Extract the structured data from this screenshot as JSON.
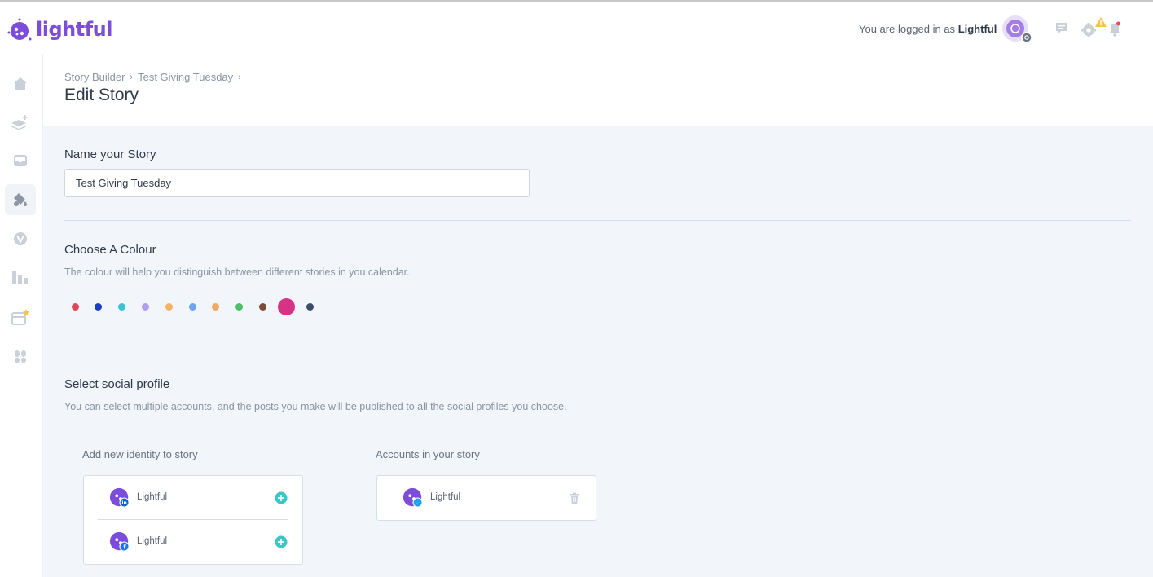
{
  "brand": {
    "name": "lightful",
    "color": "#7c4ddb"
  },
  "topbar": {
    "logged_prefix": "You are logged in as",
    "logged_user": "Lightful",
    "icons": [
      "avatar",
      "chat-icon",
      "gear-icon",
      "warning-icon",
      "bell-icon"
    ]
  },
  "sidebar": {
    "items": [
      {
        "icon": "home-icon"
      },
      {
        "icon": "layers-add-icon"
      },
      {
        "icon": "inbox-icon"
      },
      {
        "icon": "paint-bucket-icon",
        "active": true
      },
      {
        "icon": "leaf-icon"
      },
      {
        "icon": "bar-chart-icon"
      },
      {
        "icon": "calendar-star-icon"
      },
      {
        "icon": "footprints-icon"
      }
    ]
  },
  "breadcrumb": [
    "Story Builder",
    "Test Giving Tuesday"
  ],
  "page_title": "Edit Story",
  "name_section": {
    "title": "Name your Story",
    "value": "Test Giving Tuesday"
  },
  "colour_section": {
    "title": "Choose A Colour",
    "description": "The colour will help you distinguish between different stories in you calendar.",
    "colors": [
      "#e0445a",
      "#1a3fc7",
      "#3cc4d6",
      "#b49cf0",
      "#f7b267",
      "#6ea6ee",
      "#f3a864",
      "#4cbf62",
      "#7a4a3a",
      "#d63384",
      "#3e4c68"
    ],
    "selected_index": 9
  },
  "social_section": {
    "title": "Select social profile",
    "description": "You can select multiple accounts, and the posts you make will be published to all the social profiles you choose.",
    "add_label": "Add new identity to story",
    "accounts_label": "Accounts in your story",
    "available": [
      {
        "name": "Lightful",
        "network": "linkedin",
        "badge_color": "#0a66c2"
      },
      {
        "name": "Lightful",
        "network": "facebook",
        "badge_color": "#1877f2"
      }
    ],
    "in_story": [
      {
        "name": "Lightful",
        "network": "twitter",
        "badge_color": "#1da1f2"
      }
    ]
  },
  "colors": {
    "accent": "#7c4ddb",
    "add_button": "#3dc6c6",
    "content_bg": "#f2f5f9"
  }
}
